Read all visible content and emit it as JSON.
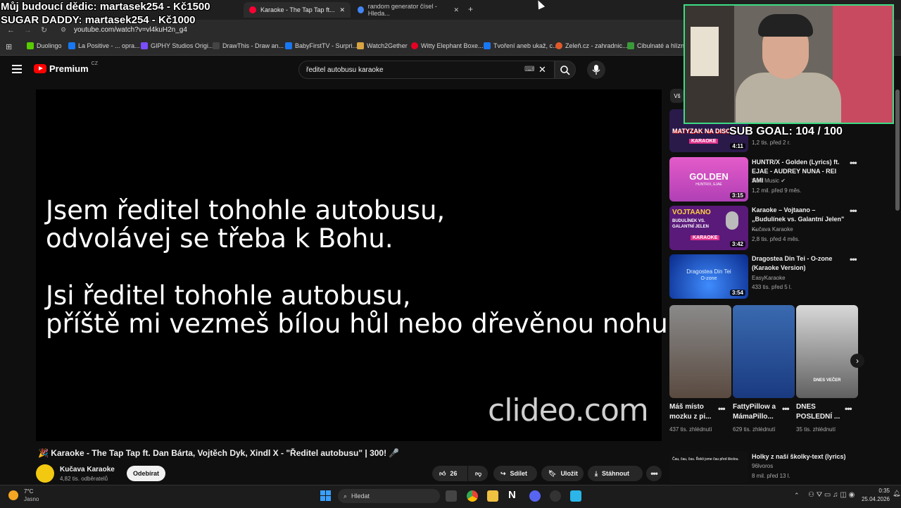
{
  "browser": {
    "tabs": [
      {
        "label": "Karaoke - The Tap Tap ft..."
      },
      {
        "label": "random generator čísel - Hleda..."
      }
    ],
    "url": "youtube.com/watch?v=vl4kuH2n_g4",
    "bookmarks": [
      {
        "label": "Duolingo"
      },
      {
        "label": "La Positive - ... opra..."
      },
      {
        "label": "GIPHY Studios Origi..."
      },
      {
        "label": "DrawThis - Draw an..."
      },
      {
        "label": "BabyFirstTV - Surpri..."
      },
      {
        "label": "Watch2Gether"
      },
      {
        "label": "Witty Elephant Boxe..."
      },
      {
        "label": "Tvoření aneb ukaž, c..."
      },
      {
        "label": "Zeleň.cz - zahradnic..."
      },
      {
        "label": "Cibulnaté a hlíznaté..."
      }
    ]
  },
  "overlay": {
    "heir": "Můj budoucí dědic: martasek254 - Kč1500",
    "sugar": "SUGAR DADDY: martasek254 - Kč1000",
    "subgoal": "SUB GOAL: 104 / 100"
  },
  "youtube": {
    "brand": "Premium",
    "region": "CZ",
    "search_value": "ředitel autobusu karaoke"
  },
  "video": {
    "lyrics": [
      "Jsem ředitel tohohle autobusu,",
      "odvolávej se třeba k Bohu.",
      "Jsi ředitel tohohle autobusu,",
      "příště mi vezmeš bílou hůl nebo dřevěnou nohu."
    ],
    "watermark": "clideo.com",
    "title": "🎉 Karaoke - The Tap Tap ft. Dan Bárta, Vojtěch Dyk, Xindl X - \"Ředitel autobusu\" | 300! 🎤",
    "channel": "Kučava Karaoke",
    "subscribers": "4,82 tis. odběratelů",
    "unsubscribe_label": "Odebírat",
    "likes": "26",
    "share_label": "Sdílet",
    "save_label": "Uložit",
    "download_label": "Stáhnout"
  },
  "sidebar": {
    "chip": "Vš",
    "videos": [
      {
        "title": "",
        "channel": "",
        "meta": "1,2 tis.   před 2 r.",
        "duration": "4:11",
        "thumb_text": "MATYZAK NA DISCU",
        "thumb_badge": "KARAOKE"
      },
      {
        "title": "HUNTR/X - Golden (Lyrics) ft. EJAE - AUDREY NUNA - REI AMI",
        "channel": "Vibe Music",
        "meta": "1,2 mil.   před 9 měs.",
        "duration": "3:15",
        "thumb_text": "GOLDEN",
        "thumb_sub": "HUNTR/X, EJAE"
      },
      {
        "title": "Karaoke – Vojtaano – „Budulínek vs. Galantní Jelen\" ...",
        "channel": "Kučava Karaoke",
        "meta": "2,8 tis.   před 4 měs.",
        "duration": "3:42",
        "thumb_text": "VOJTAANO",
        "thumb_sub": "BUDULÍNEK VS. GALANTNÍ JELEN",
        "thumb_badge": "KARAOKE"
      },
      {
        "title": "Dragostea Din Tei - O-zone (Karaoke Version)",
        "channel": "EasyKaraoke",
        "meta": "433 tis.   před 5 l.",
        "duration": "3:54",
        "thumb_text": "Dragostea Din Tei",
        "thumb_sub": "O-zone"
      },
      {
        "title": "Holky z naší školky-text (lyrics)",
        "channel": "96lvoros",
        "meta": "8 mil.   před 13 l.",
        "duration": "",
        "thumb_text": "Čau, čau, čau. Řekli jsme čau před školou."
      }
    ],
    "shorts": [
      {
        "title": "Máš místo mozku z pi...",
        "meta": "437 tis. zhlédnutí"
      },
      {
        "title": "FattyPillow a MámaPillo...",
        "meta": "629 tis. zhlédnutí"
      },
      {
        "title": "DNES POSLEDNÍ ...",
        "meta": "35 tis. zhlédnutí",
        "thumb_text": "DNES VEČER"
      }
    ]
  },
  "taskbar": {
    "weather_temp": "7°C",
    "weather_desc": "Jasno",
    "search_placeholder": "Hledat",
    "time": "0:35",
    "date": "25.04.2026"
  }
}
